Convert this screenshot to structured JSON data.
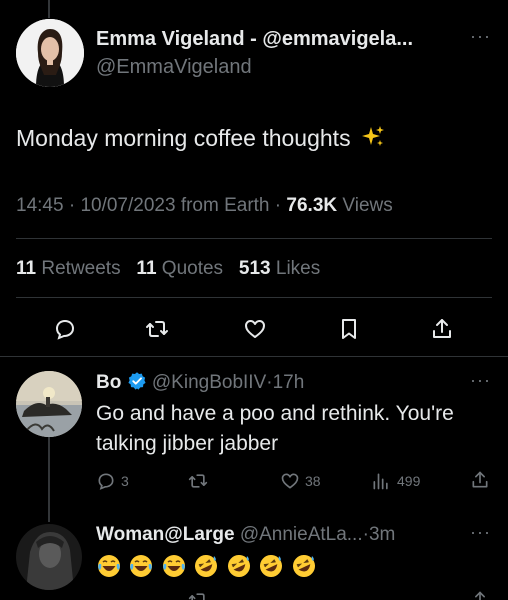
{
  "main_tweet": {
    "display_name": "Emma Vigeland - @emmavigela...",
    "handle": "@EmmaVigeland",
    "text": "Monday morning coffee thoughts",
    "sparkle_icon": "sparkles-icon",
    "time": "14:45",
    "date": "10/07/2023",
    "source": "from Earth",
    "views_count": "76.3K",
    "views_label": "Views",
    "retweets_count": "11",
    "retweets_label": "Retweets",
    "quotes_count": "11",
    "quotes_label": "Quotes",
    "likes_count": "513",
    "likes_label": "Likes",
    "actions": [
      "reply-icon",
      "retweet-icon",
      "like-icon",
      "bookmark-icon",
      "share-icon"
    ]
  },
  "replies": [
    {
      "display_name": "Bo",
      "verified": true,
      "handle": "@KingBobIIV",
      "time": "17h",
      "text_line1": "Go and have a poo and rethink. You're",
      "text_line2": "talking jibber jabber",
      "reply_count": "3",
      "retweet_count": "",
      "like_count": "38",
      "view_count": "499"
    },
    {
      "display_name": "Woman@Large",
      "handle": "@AnnieAtLa...",
      "time": "3m",
      "emoji_sequence": [
        "laughing-crying",
        "laughing-crying",
        "laughing-crying",
        "rolling-laughing",
        "rolling-laughing",
        "rolling-laughing",
        "rolling-laughing"
      ]
    }
  ],
  "colors": {
    "background": "#000000",
    "text": "#e7e9ea",
    "muted": "#71767b",
    "divider": "#2f3336",
    "verified": "#1d9bf0",
    "sparkle": "#f5c518"
  }
}
